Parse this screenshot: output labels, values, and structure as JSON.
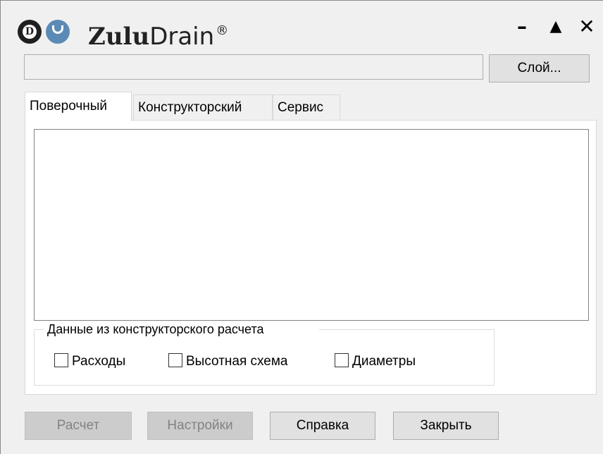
{
  "app": {
    "title_bold": "Zulu",
    "title_regular": "Drain",
    "title_mark": "®",
    "logo_letter": "D"
  },
  "window_controls": {
    "minimize": "–",
    "maximize": "▲",
    "close": "✕"
  },
  "layer": {
    "value": "",
    "button_label": "Слой..."
  },
  "tabs": [
    {
      "label": "Поверочный",
      "active": true
    },
    {
      "label": "Конструкторский",
      "active": false
    },
    {
      "label": "Сервис",
      "active": false
    }
  ],
  "design_data": {
    "legend": "Данные из конструкторского расчета",
    "checkboxes": [
      {
        "label": "Расходы",
        "checked": false
      },
      {
        "label": "Высотная схема",
        "checked": false
      },
      {
        "label": "Диаметры",
        "checked": false
      }
    ]
  },
  "buttons": [
    {
      "label": "Расчет",
      "enabled": false
    },
    {
      "label": "Настройки",
      "enabled": false
    },
    {
      "label": "Справка",
      "enabled": true
    },
    {
      "label": "Закрыть",
      "enabled": true
    }
  ],
  "colors": {
    "window_bg": "#f0f0f0",
    "button_bg": "#e1e1e1",
    "disabled_button_bg": "#cccccc",
    "logo_drop": "#5b8ab5"
  }
}
